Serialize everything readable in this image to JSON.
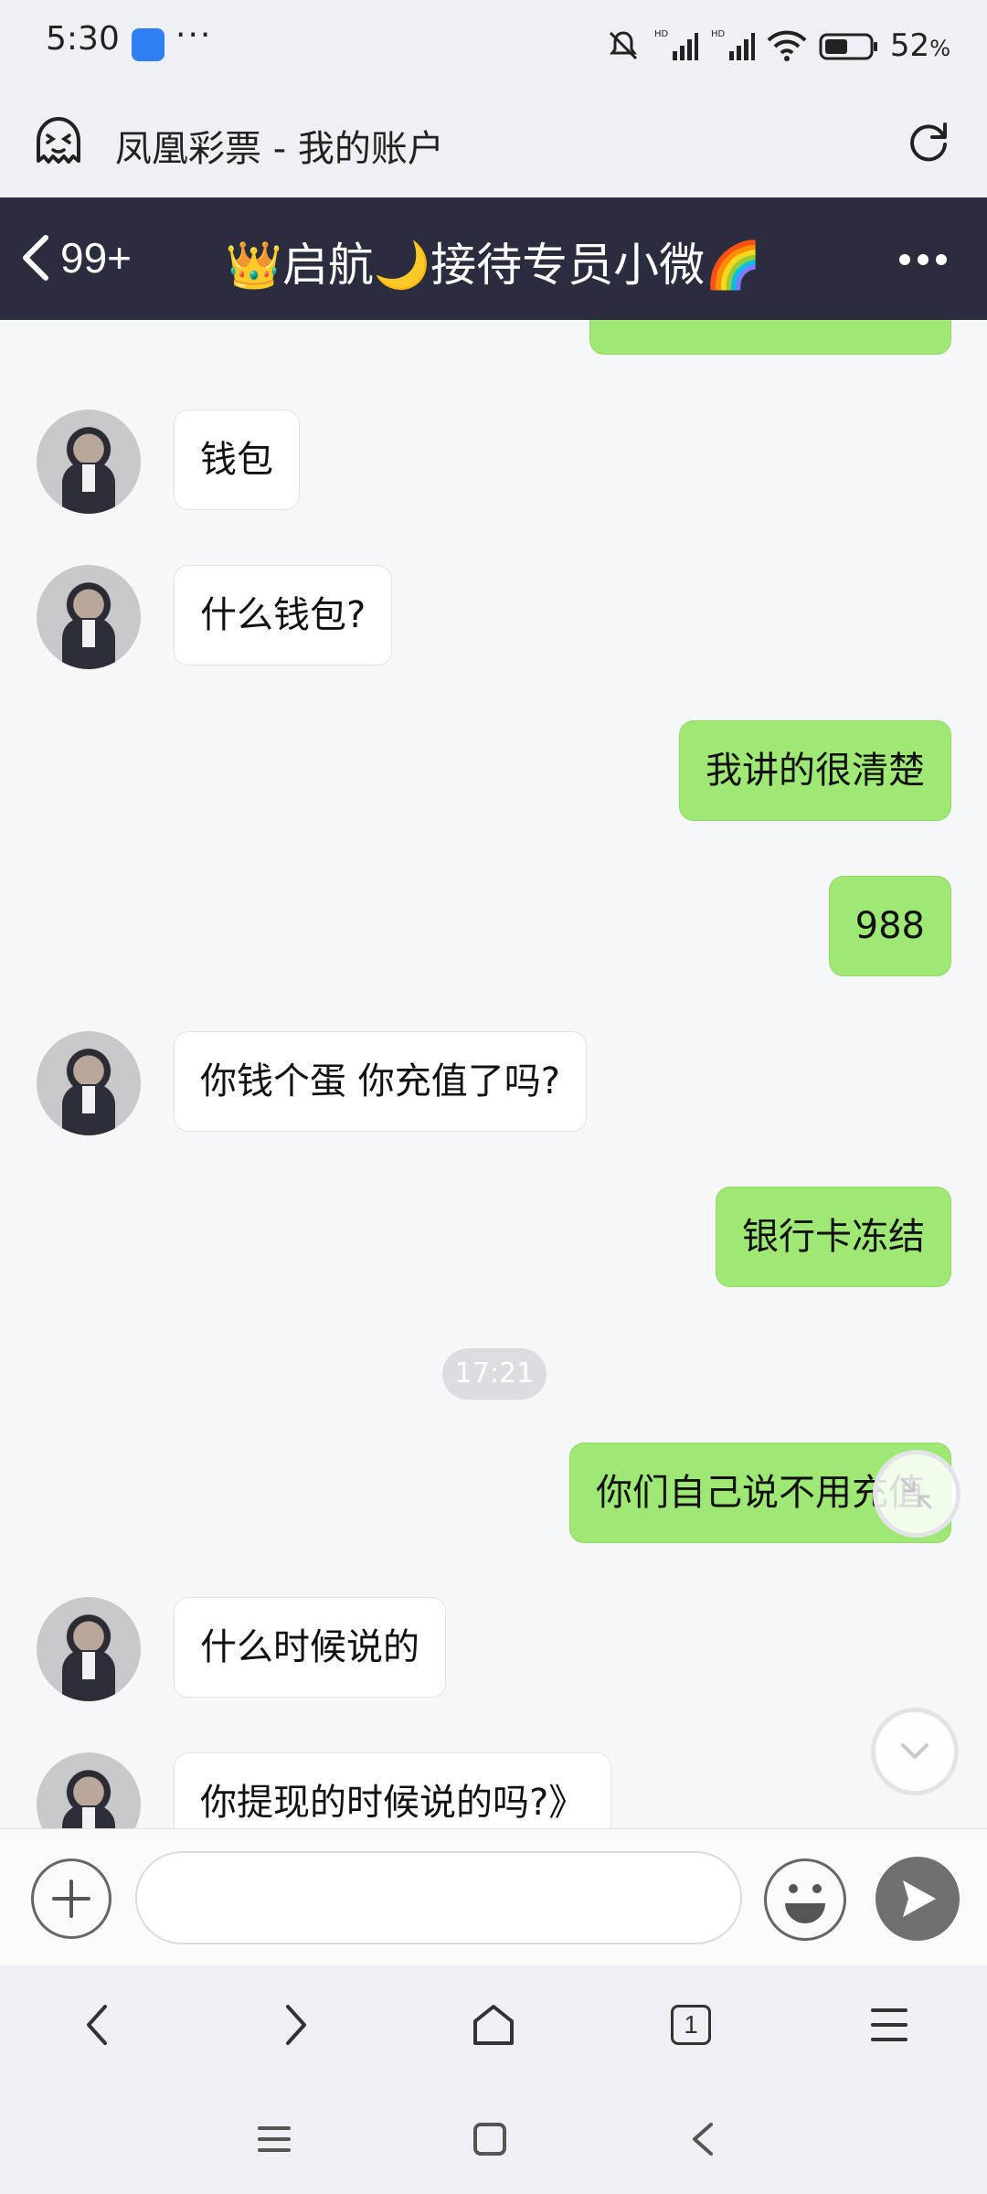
{
  "status_bar": {
    "time": "5:30",
    "more_dots": "···",
    "battery_percent": "52",
    "battery_unit": "%",
    "battery_level": 0.52
  },
  "browser": {
    "page_title": "凤凰彩票 - 我的账户",
    "tab_count": "1"
  },
  "chat": {
    "back_count": "99+",
    "title": "👑启航🌙接待专员小微🌈",
    "timestamp": "17:21",
    "messages": [
      {
        "from": "agent",
        "text": "钱包"
      },
      {
        "from": "agent",
        "text": "什么钱包?"
      },
      {
        "from": "me",
        "text": "我讲的很清楚"
      },
      {
        "from": "me",
        "text": "988"
      },
      {
        "from": "agent",
        "text": "你钱个蛋 你充值了吗?"
      },
      {
        "from": "me",
        "text": "银行卡冻结"
      },
      {
        "from": "me",
        "text": "你们自己说不用充值"
      },
      {
        "from": "agent",
        "text": "什么时候说的"
      },
      {
        "from": "agent",
        "text": "你提现的时候说的吗?》"
      }
    ]
  },
  "input": {
    "value": "",
    "placeholder": ""
  },
  "colors": {
    "header_bg": "#2a2d3d",
    "outgoing_bubble": "#9fe876",
    "incoming_bubble": "#ffffff",
    "page_bg": "#f6f7f9"
  },
  "icons": {
    "app_logo": "ghost-icon",
    "reload": "reload-icon",
    "back": "chevron-left-icon",
    "more": "more-dots-icon",
    "plus": "plus-icon",
    "emoji": "emoji-icon",
    "send": "send-icon",
    "collapse": "collapse-icon",
    "scroll_down": "chevron-down-icon"
  }
}
